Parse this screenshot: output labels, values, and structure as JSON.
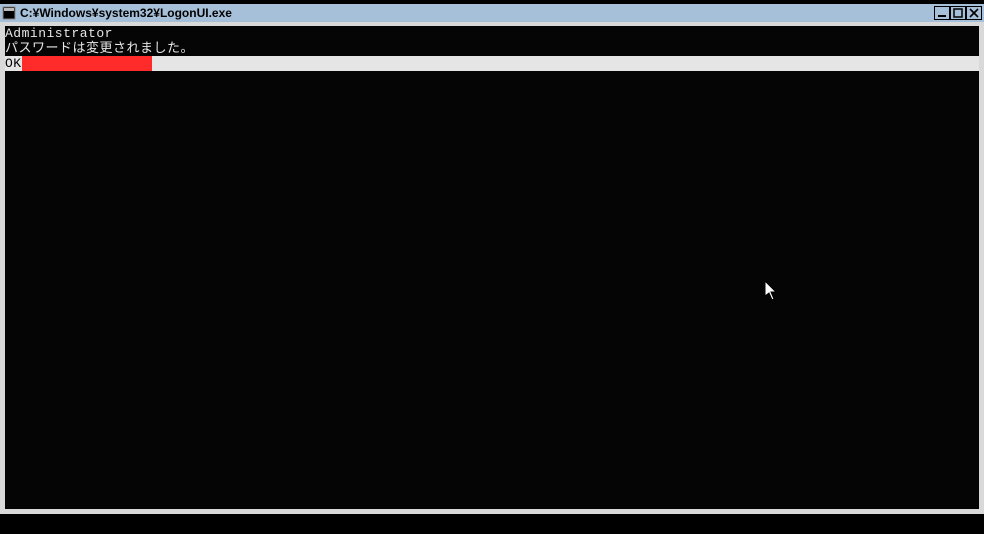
{
  "window": {
    "title": "C:¥Windows¥system32¥LogonUI.exe"
  },
  "console": {
    "user_line": "Administrator",
    "message_line": "パスワードは変更されました。",
    "ok_label": "OK"
  },
  "titlebar_buttons": {
    "minimize": "minimize",
    "maximize": "maximize",
    "close": "close"
  }
}
